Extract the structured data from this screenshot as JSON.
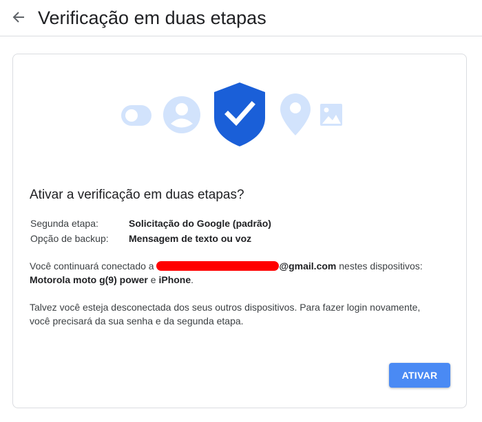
{
  "header": {
    "title": "Verificação em duas etapas",
    "back_icon": "arrow-back-icon"
  },
  "card": {
    "illustration_icons": [
      "toggle-icon",
      "account-icon",
      "shield-check-icon",
      "location-pin-icon",
      "image-icon"
    ],
    "heading": "Ativar a verificação em duas etapas?",
    "second_step": {
      "label": "Segunda etapa:",
      "value": "Solicitação do Google (padrão)"
    },
    "backup_option": {
      "label": "Opção de backup:",
      "value": "Mensagem de texto ou voz"
    },
    "connected_text": {
      "prefix": "Você continuará conectado a ",
      "email_suffix": "@gmail.com",
      "middle": " nestes dispositivos:",
      "device1": "Motorola moto g(9) power",
      "conjunction": " e ",
      "device2": "iPhone",
      "end": "."
    },
    "warning_text": "Talvez você esteja desconectada dos seus outros dispositivos. Para fazer login novamente, você precisará da sua senha e da segunda etapa.",
    "activate_label": "ATIVAR"
  },
  "colors": {
    "accent": "#4a8af4",
    "shield": "#1a5fd8",
    "icon_light": "#d2e3fc",
    "redaction": "#ff0000"
  }
}
